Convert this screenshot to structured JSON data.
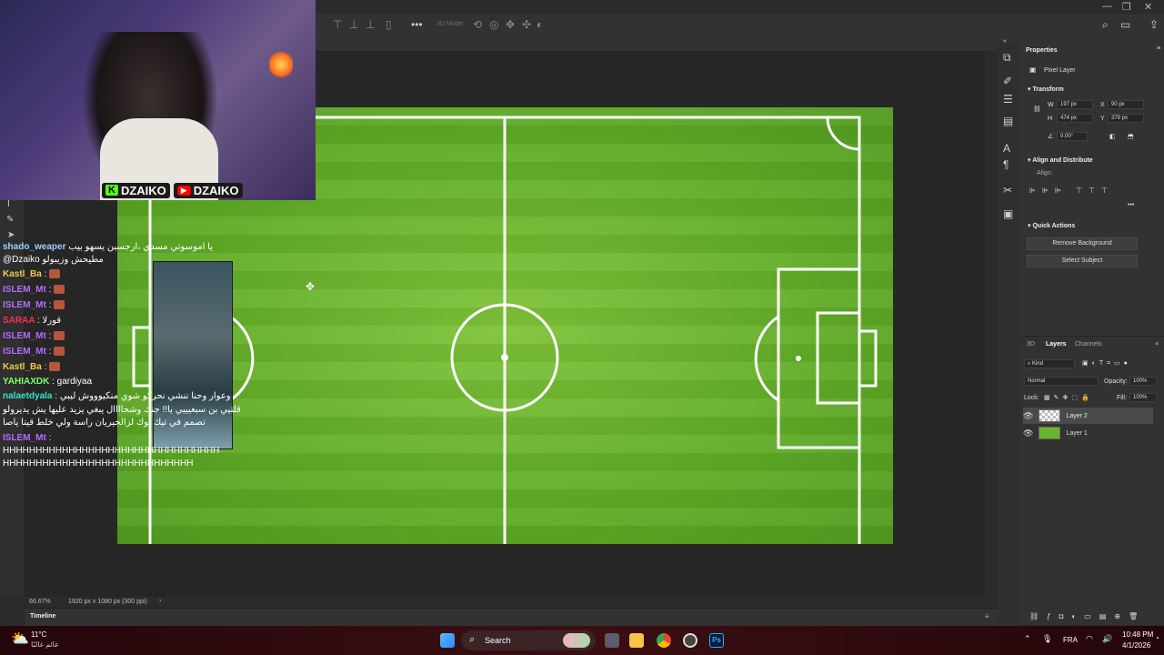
{
  "optbar": {
    "mode_label": "3D Mode:",
    "window_controls": [
      "—",
      "❐",
      "✕"
    ]
  },
  "stream": {
    "kick_name": "DZAIKO",
    "youtube_name": "DZAIKO",
    "kick_badge": "K"
  },
  "chat": [
    {
      "user": "shado_weaper",
      "msg": "يا اموسوتي مسدي ،ارجسبن يسهو بيب",
      "color": "#9bd1ff"
    },
    {
      "user": "",
      "msg": "@Dzaiko مطيحش وزيبولو",
      "color": "#ffffff",
      "mention": "@Dzaiko"
    },
    {
      "user": "Kastl_Ba",
      "msg": ":",
      "color": "#f2c94c",
      "emote": true
    },
    {
      "user": "ISLEM_Mt",
      "msg": ":",
      "color": "#b36bff",
      "emote": true
    },
    {
      "user": "ISLEM_Mt",
      "msg": ":",
      "color": "#b36bff",
      "emote": true
    },
    {
      "user": "SARAA",
      "msg": ": قورلا",
      "color": "#ff2d55"
    },
    {
      "user": "ISLEM_Mt",
      "msg": ":",
      "color": "#b36bff",
      "emote": true
    },
    {
      "user": "ISLEM_Mt",
      "msg": ":",
      "color": "#b36bff",
      "emote": true
    },
    {
      "user": "Kastl_Ba",
      "msg": ":",
      "color": "#f2c94c",
      "emote": true
    },
    {
      "user": "YAHIAXDK",
      "msg": ": gardiyaa",
      "color": "#7cff6b"
    },
    {
      "user": "nalaetdyala",
      "msg": ": وعوار وحنا ننشي نحركو شوي منكيوووش ليبي",
      "color": "#36e3c8"
    },
    {
      "user": "",
      "msg": "قلتيي بن سبعيييي يا!! جنك وشحاااال يبغي يزيد عليها يش يديرولو",
      "color": "#ffffff"
    },
    {
      "user": "",
      "msg": "تصمم في تيك توك لزالجيريان راسة ولي خلط قيتا ياصا",
      "color": "#ffffff"
    },
    {
      "user": "ISLEM_Mt",
      "msg": ":",
      "color": "#b36bff"
    },
    {
      "user": "",
      "msg": "HHHHHHHHHHHHHHHHHHHHHHHHHHHHHHHHH",
      "color": "#ffffff"
    },
    {
      "user": "",
      "msg": "HHHHHHHHHHHHHHHHHHHHHHHHHHHHH",
      "color": "#ffffff"
    }
  ],
  "statusbar": {
    "zoom": "66.67%",
    "doc_info": "1920 px x 1080 px (300 ppi)"
  },
  "timeline": {
    "label": "Timeline"
  },
  "properties": {
    "title": "Properties",
    "layer_type": "Pixel Layer",
    "transform_title": "Transform",
    "w_label": "W",
    "w_value": "197 px",
    "h_label": "H",
    "h_value": "474 px",
    "x_label": "X",
    "x_value": "90 px",
    "y_label": "Y",
    "y_value": "379 px",
    "angle_value": "0.00°",
    "align_title": "Align and Distribute",
    "align_label": "Align:",
    "quick_title": "Quick Actions",
    "remove_bg": "Remove Background",
    "select_subject": "Select Subject"
  },
  "layers_panel": {
    "tabs": [
      "3D",
      "Layers",
      "Channels"
    ],
    "kind": "Kind",
    "blend": "Normal",
    "opacity_label": "Opacity:",
    "opacity_value": "100%",
    "lock_label": "Lock:",
    "fill_label": "Fill:",
    "fill_value": "100%",
    "layers": [
      {
        "name": "Layer 2",
        "selected": true
      },
      {
        "name": "Layer 1",
        "selected": false
      }
    ]
  },
  "taskbar": {
    "weather_temp": "11°C",
    "weather_desc": "غائم غالبًا",
    "search": "Search",
    "lang": "FRA",
    "time": "10:48 PM",
    "date": "4/1/2026"
  },
  "colors": {
    "ps_blue": "#31a8ff",
    "chrome_red": "#ea4335",
    "folder_yellow": "#f6c744",
    "win_blue": "#2b8cff"
  }
}
